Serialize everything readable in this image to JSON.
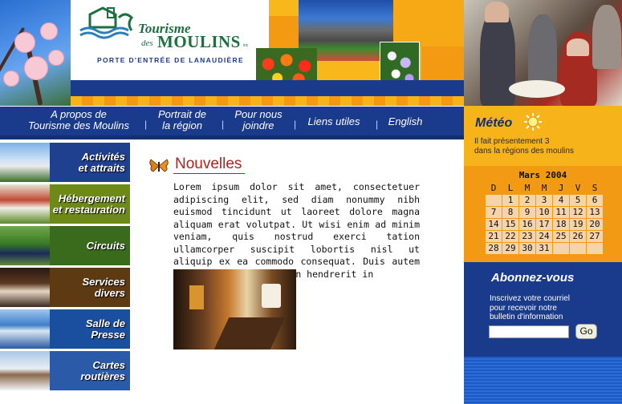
{
  "header": {
    "logo": {
      "line1": "Tourisme",
      "line2a": "des",
      "line2b": "MOULINS",
      "suffix": "inc",
      "tagline": "PORTE D'ENTRÉE DE LANAUDIÈRE"
    }
  },
  "nav": {
    "items": [
      {
        "line1": "A propos de",
        "line2": "Tourisme des Moulins"
      },
      {
        "line1": "Portrait de",
        "line2": "la région"
      },
      {
        "line1": "Pour nous",
        "line2": "joindre"
      },
      {
        "line1": "Liens utiles",
        "line2": ""
      },
      {
        "line1": "English",
        "line2": ""
      }
    ]
  },
  "sidebar": {
    "items": [
      {
        "line1": "Activités",
        "line2": "et attraits",
        "color": "#1f3f8f"
      },
      {
        "line1": "Hébergement",
        "line2": "et restauration",
        "color": "#6d8a18"
      },
      {
        "line1": "Circuits",
        "line2": "",
        "color": "#3a6a1c"
      },
      {
        "line1": "Services",
        "line2": "divers",
        "color": "#5e3a12"
      },
      {
        "line1": "Salle de",
        "line2": "Presse",
        "color": "#1a4fa0"
      },
      {
        "line1": "Cartes",
        "line2": "routières",
        "color": "#2a5aa8"
      }
    ]
  },
  "news": {
    "title": "Nouvelles",
    "body": "Lorem ipsum dolor sit amet, consectetuer adipiscing elit, sed diam nonummy nibh euismod tincidunt ut laoreet dolore magna aliquam erat volutpat. Ut wisi enim ad minim veniam, quis nostrud exerci tation ullamcorper suscipit lobortis nisl ut aliquip ex ea commodo consequat. Duis autem vel eum iriure dolor in hendrerit in"
  },
  "meteo": {
    "title": "Météo",
    "line1": "Il fait présentement 3",
    "line2": "dans la régions des moulins"
  },
  "calendar": {
    "title": "Mars 2004",
    "weekdays": [
      "D",
      "L",
      "M",
      "M",
      "J",
      "V",
      "S"
    ],
    "weeks": [
      [
        "",
        "1",
        "2",
        "3",
        "4",
        "5",
        "6"
      ],
      [
        "7",
        "8",
        "9",
        "10",
        "11",
        "12",
        "13"
      ],
      [
        "14",
        "15",
        "16",
        "17",
        "18",
        "19",
        "20"
      ],
      [
        "21",
        "22",
        "23",
        "24",
        "25",
        "26",
        "27"
      ],
      [
        "28",
        "29",
        "30",
        "31",
        "",
        "",
        ""
      ]
    ]
  },
  "newsletter": {
    "title": "Abonnez-vous",
    "line1": "Inscrivez votre courriel",
    "line2": "pour recevoir notre",
    "line3": "bulletin d'information",
    "email_value": "",
    "button_label": "Go"
  },
  "colors": {
    "brand_blue": "#1a3a8c",
    "gold": "#f6b31a",
    "orange": "#f39a14",
    "news_red": "#b0221d",
    "logo_green": "#1e6f3f"
  }
}
